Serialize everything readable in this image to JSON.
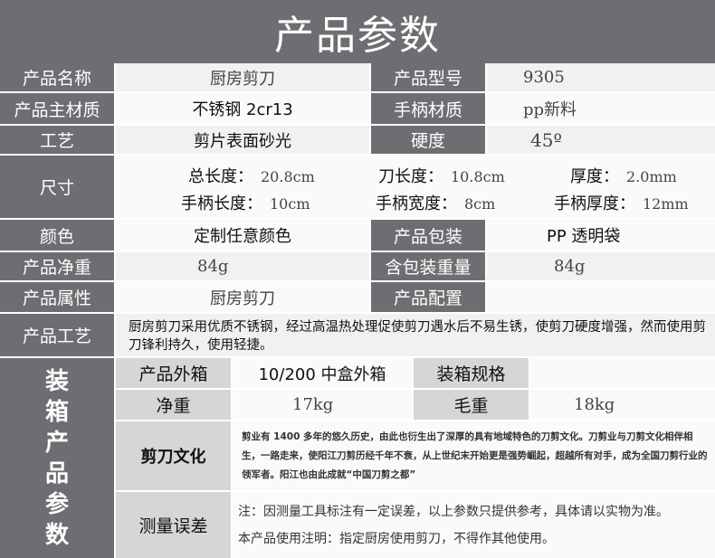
{
  "title": "产品参数",
  "rows": {
    "name": {
      "label": "产品名称",
      "value": "厨房剪刀",
      "label2": "产品型号",
      "value2": "9305"
    },
    "material": {
      "label": "产品主材质",
      "value": "不锈钢 2cr13",
      "label2": "手柄材质",
      "value2": "pp新料"
    },
    "craft": {
      "label": "工艺",
      "value": "剪片表面砂光",
      "label2": "硬度",
      "value2": "45º"
    },
    "size": {
      "label": "尺寸",
      "total_length_label": "总长度：",
      "total_length": "20.8cm",
      "blade_length_label": "刀长度：",
      "blade_length": "10.8cm",
      "thickness_label": "厚度：",
      "thickness": "2.0mm",
      "handle_length_label": "手柄长度：",
      "handle_length": "10cm",
      "handle_width_label": "手柄宽度：",
      "handle_width": "8cm",
      "handle_thickness_label": "手柄厚度：",
      "handle_thickness": "12mm"
    },
    "color": {
      "label": "颜色",
      "value": "定制任意颜色",
      "label2": "产品包装",
      "value2": "PP 透明袋"
    },
    "weight": {
      "label": "产品净重",
      "value": "84g",
      "label2": "含包装重量",
      "value2": "84g"
    },
    "attribute": {
      "label": "产品属性",
      "value": "厨房剪刀",
      "label2": "产品配置",
      "value2": ""
    },
    "process": {
      "label": "产品工艺",
      "text": "厨房剪刀采用优质不锈钢，经过高温热处理促使剪刀遇水后不易生锈，使剪刀硬度增强，然而使用剪刀锋利持久，使用轻捷。"
    }
  },
  "packing": {
    "side_label": [
      "装",
      "箱",
      "产",
      "品",
      "参",
      "数"
    ],
    "box_label": "产品外箱",
    "box_value": "10/200 中盒外箱",
    "spec_label": "装箱规格",
    "spec_value": "",
    "net_label": "净重",
    "net_value": "17kg",
    "gross_label": "毛重",
    "gross_value": "18kg",
    "culture_label": "剪刀文化",
    "culture_text": "剪业有 1400 多年的悠久历史，由此也衍生出了深厚的具有地域特色的刀剪文化。刀剪业与刀剪文化相伴相生，一路走来，使阳江刀剪历经千年不衰，从上世纪末开始更是强势崛起，超越所有对手，成为全国刀剪行业的领军者。阳江也由此成就“中国刀剪之都”",
    "error_label": "测量误差",
    "error_note": "注：因测量工具标注有一定误差，以上参数只提供参考，具体请以实物为准。",
    "usage_note": "本产品使用注明：指定厨房使用剪刀，不得作其他使用。"
  }
}
